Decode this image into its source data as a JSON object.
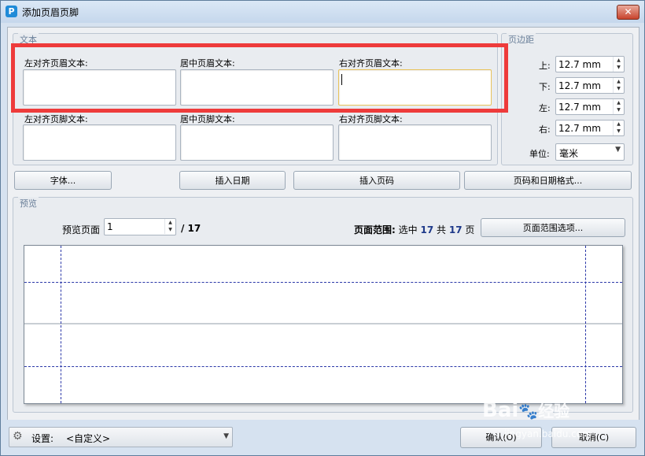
{
  "window": {
    "title": "添加页眉页脚",
    "app_icon": "P"
  },
  "text_section": {
    "label": "文本",
    "left_header_label": "左对齐页眉文本:",
    "center_header_label": "居中页眉文本:",
    "right_header_label": "右对齐页眉文本:",
    "left_footer_label": "左对齐页脚文本:",
    "center_footer_label": "居中页脚文本:",
    "right_footer_label": "右对齐页脚文本:"
  },
  "margins": {
    "label": "页边距",
    "top_label": "上:",
    "top_value": "12.7 mm",
    "bottom_label": "下:",
    "bottom_value": "12.7 mm",
    "left_label": "左:",
    "left_value": "12.7 mm",
    "right_label": "右:",
    "right_value": "12.7 mm",
    "unit_label": "单位:",
    "unit_value": "毫米"
  },
  "toolbar": {
    "font_button": "字体...",
    "insert_date_button": "插入日期",
    "insert_page_button": "插入页码",
    "format_button": "页码和日期格式..."
  },
  "preview": {
    "label": "预览",
    "page_label": "预览页面",
    "page_value": "1",
    "page_total": "/ 17",
    "range_label": "页面范围:",
    "range_selected_prefix": "选中",
    "range_selected": "17",
    "range_total_prefix": "共",
    "range_total": "17",
    "range_suffix": "页",
    "range_options_button": "页面范围选项..."
  },
  "footer": {
    "settings_label": "设置:",
    "settings_value": "<自定义>",
    "ok_button": "确认(O)",
    "cancel_button": "取消(C)"
  },
  "watermark": {
    "brand": "Bai",
    "brand_cn": "经验",
    "url": "jingyan.baidu.com"
  },
  "colors": {
    "highlight_box": "#ee3b3b",
    "guide": "#2a37a8",
    "accent_blue": "#1f3a8a"
  }
}
